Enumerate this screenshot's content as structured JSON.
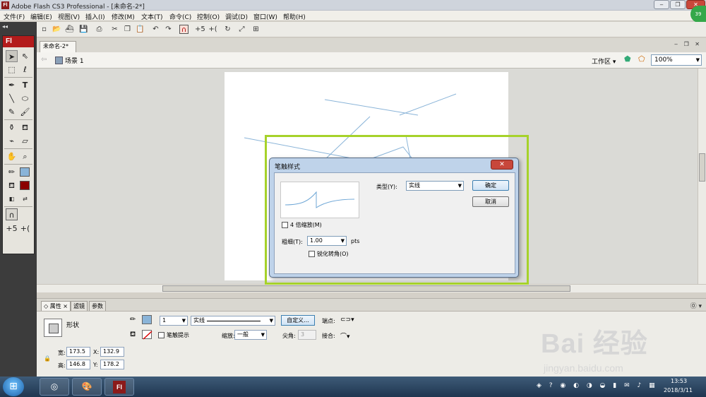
{
  "window": {
    "icon": "Fl",
    "title": "Adobe Flash CS3 Professional - [未命名-2*]",
    "controls": {
      "minimize": "‒",
      "restore": "❐",
      "close": "✕"
    },
    "badge": "39"
  },
  "menu": [
    "文件(F)",
    "编辑(E)",
    "视图(V)",
    "插入(I)",
    "修改(M)",
    "文本(T)",
    "命令(C)",
    "控制(O)",
    "调试(D)",
    "窗口(W)",
    "帮助(H)"
  ],
  "toolbar_icons": [
    "new-icon",
    "open-icon",
    "bridge-icon",
    "save-icon",
    "print-icon",
    "cut-icon",
    "copy-icon",
    "paste-icon",
    "undo-icon",
    "redo-icon",
    "snap-magnet-icon",
    "smooth-icon",
    "straighten-icon",
    "rotate-icon",
    "scale-icon",
    "align-icon"
  ],
  "tools": {
    "logo": "Fl",
    "collapse": "◂◂"
  },
  "document": {
    "tab_label": "未命名-2*",
    "window_ctrls": "‒ ❐ ✕",
    "scene_label": "场景 1",
    "workspace_label": "工作区",
    "zoom": "100%"
  },
  "dialog": {
    "title": "笔触样式",
    "close": "✕",
    "zoom_checkbox_label": "4 倍缩放(M)",
    "width_label": "粗细(T):",
    "width_value": "1.00",
    "width_unit": "pts",
    "sharp_corners_label": "锐化转角(O)",
    "type_label": "类型(Y):",
    "type_value": "实线",
    "ok_label": "确定",
    "cancel_label": "取消"
  },
  "properties": {
    "tabs": [
      "属性",
      "滤镜",
      "参数"
    ],
    "tab_close": "×",
    "help": "⓪ ▾",
    "shape_label": "形状",
    "width_label": "宽:",
    "width_value": "173.5",
    "height_label": "高:",
    "height_value": "146.8",
    "x_label": "X:",
    "x_value": "132.9",
    "y_label": "Y:",
    "y_value": "178.2",
    "stroke_weight": "1",
    "stroke_style": "实线",
    "custom_button": "自定义...",
    "stroke_hint_label": "笔触提示",
    "scale_label": "缩放:",
    "scale_value": "一般",
    "miter_label": "尖角:",
    "miter_value": "3",
    "cap_label": "端点:",
    "join_label": "接合:"
  },
  "taskbar": {
    "start": "⊞",
    "clock_time": "13:53",
    "clock_date": "2018/3/11",
    "tray_icons": "◈ ? ◉ ◐ ◑ ◒ ▮ ✉ ♪ ▦"
  },
  "watermark": {
    "brand": "Bai 经验",
    "url": "jingyan.baidu.com"
  },
  "colors": {
    "highlight": "#a6d22a",
    "stroke_color": "#8ab4d8",
    "flash_red": "#b31b1b"
  }
}
